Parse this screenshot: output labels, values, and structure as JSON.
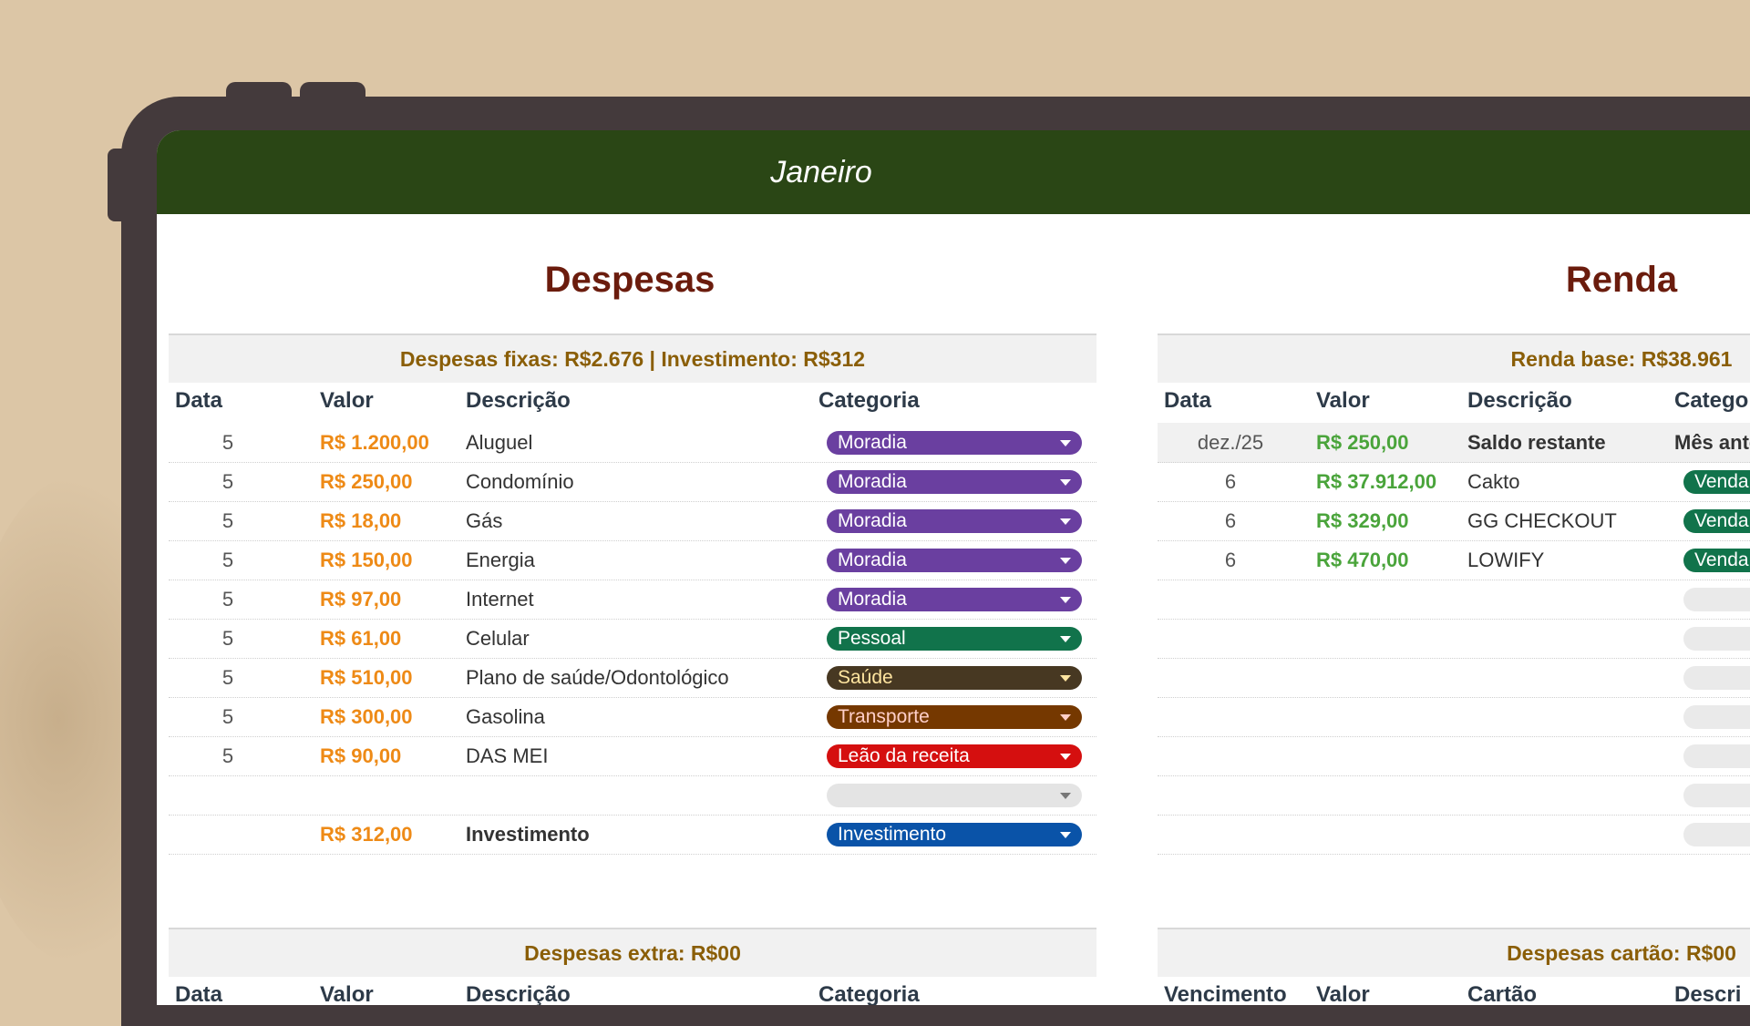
{
  "month_title": "Janeiro",
  "expenses": {
    "title": "Despesas",
    "summary": "Despesas fixas: R$2.676 | Investimento: R$312",
    "columns": {
      "date": "Data",
      "value": "Valor",
      "description": "Descrição",
      "category": "Categoria"
    },
    "rows": [
      {
        "date": "5",
        "value": "R$ 1.200,00",
        "description": "Aluguel",
        "category": "Moradia",
        "color": "#6a3fa0"
      },
      {
        "date": "5",
        "value": "R$ 250,00",
        "description": "Condomínio",
        "category": "Moradia",
        "color": "#6a3fa0"
      },
      {
        "date": "5",
        "value": "R$ 18,00",
        "description": "Gás",
        "category": "Moradia",
        "color": "#6a3fa0"
      },
      {
        "date": "5",
        "value": "R$ 150,00",
        "description": "Energia",
        "category": "Moradia",
        "color": "#6a3fa0"
      },
      {
        "date": "5",
        "value": "R$ 97,00",
        "description": "Internet",
        "category": "Moradia",
        "color": "#6a3fa0"
      },
      {
        "date": "5",
        "value": "R$ 61,00",
        "description": "Celular",
        "category": "Pessoal",
        "color": "#11734b"
      },
      {
        "date": "5",
        "value": "R$ 510,00",
        "description": "Plano de saúde/Odontológico",
        "category": "Saúde",
        "color": "#473822",
        "text_color": "#ffe5a0"
      },
      {
        "date": "5",
        "value": "R$ 300,00",
        "description": "Gasolina",
        "category": "Transporte",
        "color": "#753800",
        "text_color": "#ffcfc9"
      },
      {
        "date": "5",
        "value": "R$ 90,00",
        "description": "DAS MEI",
        "category": "Leão da receita",
        "color": "#d50f0f"
      },
      {
        "date": "",
        "value": "",
        "description": "",
        "category": "",
        "color": "#e4e4e4"
      },
      {
        "date": "",
        "value": "R$ 312,00",
        "description": "Investimento",
        "category": "Investimento",
        "color": "#0a53a8"
      }
    ],
    "extra_summary": "Despesas extra: R$00",
    "extra_columns": {
      "date": "Data",
      "value": "Valor",
      "description": "Descrição",
      "category": "Categoria"
    }
  },
  "income": {
    "title": "Renda",
    "summary": "Renda base: R$38.961",
    "columns": {
      "date": "Data",
      "value": "Valor",
      "description": "Descrição",
      "category": "Categor"
    },
    "rows": [
      {
        "date": "dez./25",
        "value": "R$ 250,00",
        "description": "Saldo restante",
        "category": "Mês ante",
        "color": ""
      },
      {
        "date": "6",
        "value": "R$ 37.912,00",
        "description": "Cakto",
        "category": "Venda",
        "color": "#11734b"
      },
      {
        "date": "6",
        "value": "R$ 329,00",
        "description": "GG CHECKOUT",
        "category": "Venda",
        "color": "#11734b"
      },
      {
        "date": "6",
        "value": "R$ 470,00",
        "description": "LOWIFY",
        "category": "Venda",
        "color": "#11734b"
      },
      {
        "date": "",
        "value": "",
        "description": "",
        "category": "",
        "color": "#eaeaea"
      },
      {
        "date": "",
        "value": "",
        "description": "",
        "category": "",
        "color": "#eaeaea"
      },
      {
        "date": "",
        "value": "",
        "description": "",
        "category": "",
        "color": "#eaeaea"
      },
      {
        "date": "",
        "value": "",
        "description": "",
        "category": "",
        "color": "#eaeaea"
      },
      {
        "date": "",
        "value": "",
        "description": "",
        "category": "",
        "color": "#eaeaea"
      },
      {
        "date": "",
        "value": "",
        "description": "",
        "category": "",
        "color": "#eaeaea"
      },
      {
        "date": "",
        "value": "",
        "description": "",
        "category": "",
        "color": "#eaeaea"
      }
    ],
    "card_summary": "Despesas cartão: R$00",
    "card_columns": {
      "due": "Vencimento",
      "value": "Valor",
      "card": "Cartão",
      "description": "Descri"
    }
  }
}
